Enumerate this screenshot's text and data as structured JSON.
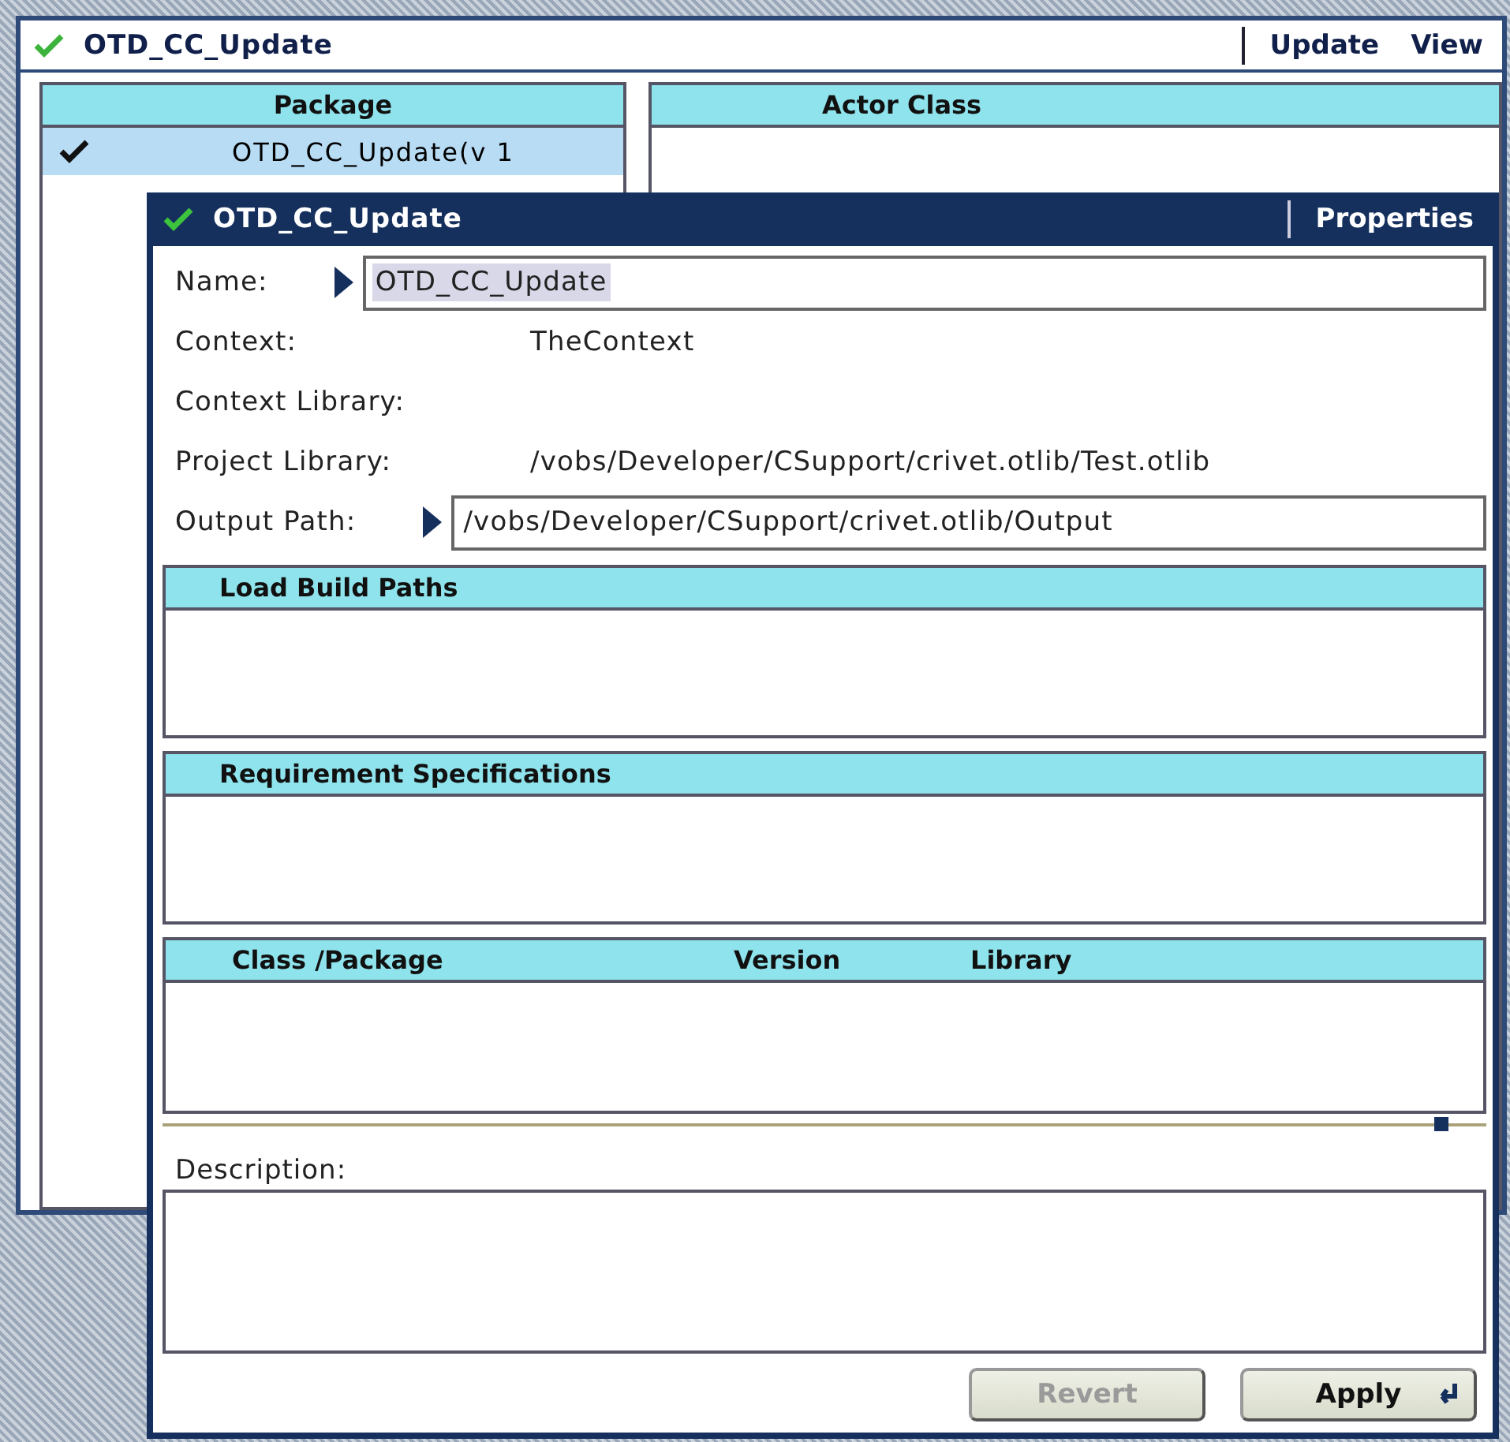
{
  "main_window": {
    "title": "OTD_CC_Update",
    "menu": [
      "Update",
      "View"
    ],
    "package_list": {
      "header": "Package",
      "rows": [
        {
          "label": "OTD_CC_Update(v 1",
          "selected": true,
          "checked": true
        }
      ]
    },
    "actor_class_list": {
      "header": "Actor Class"
    }
  },
  "properties_dialog": {
    "title": "OTD_CC_Update",
    "menu": [
      "Properties"
    ],
    "fields": [
      {
        "kind": "input",
        "label": "Name:",
        "value": "OTD_CC_Update",
        "selected": true
      },
      {
        "kind": "text",
        "label": "Context:",
        "value": "TheContext"
      },
      {
        "kind": "text",
        "label": "Context Library:"
      },
      {
        "kind": "text",
        "label": "Project Library:",
        "value": "/vobs/Developer/CSupport/crivet.otlib/Test.otlib"
      },
      {
        "kind": "input",
        "label": "Output Path:",
        "value": "/vobs/Developer/CSupport/crivet.otlib/Output",
        "selected": false
      }
    ],
    "lists": [
      {
        "header": "Load Build Paths"
      },
      {
        "header": "Requirement Specifications"
      }
    ],
    "table": {
      "columns": [
        "Class /Package",
        "Version",
        "Library"
      ]
    },
    "description": {
      "label": "Description:"
    },
    "buttons": [
      {
        "label": "Revert",
        "disabled": true,
        "default": false
      },
      {
        "label": "Apply",
        "disabled": false,
        "default": true
      }
    ]
  }
}
